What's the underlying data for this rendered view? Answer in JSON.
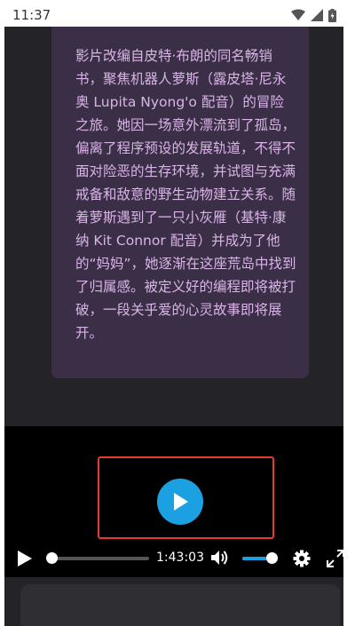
{
  "status_bar": {
    "time": "11:37",
    "icons": [
      "wifi-icon",
      "signal-icon",
      "battery-icon"
    ]
  },
  "description": {
    "text": "影片改编自皮特·布朗的同名畅销书，聚焦机器人萝斯（露皮塔·尼永奥 Lupita Nyong'o 配音）的冒险之旅。她因一场意外漂流到了孤岛，偏离了程序预设的发展轨道，不得不面对险恶的生存环境，并试图与充满戒备和敌意的野生动物建立关系。随着萝斯遇到了一只小灰雁（基特·康纳 Kit Connor 配音）并成为了他的“妈妈”，她逐渐在这座荒岛中找到了归属感。被定义好的编程即将被打破，一段关乎爱的心灵故事即将展开。"
  },
  "player": {
    "duration": "1:43:03",
    "progress": 0,
    "volume": 0.75,
    "icons": {
      "big_play": "play-icon",
      "play": "play-icon",
      "volume": "volume-icon",
      "settings": "gear-icon",
      "fullscreen": "fullscreen-icon"
    }
  },
  "colors": {
    "accent": "#1ba1e2",
    "card_bg": "#3b2f48",
    "card_text": "#d9b4e6",
    "highlight": "#e53935"
  }
}
